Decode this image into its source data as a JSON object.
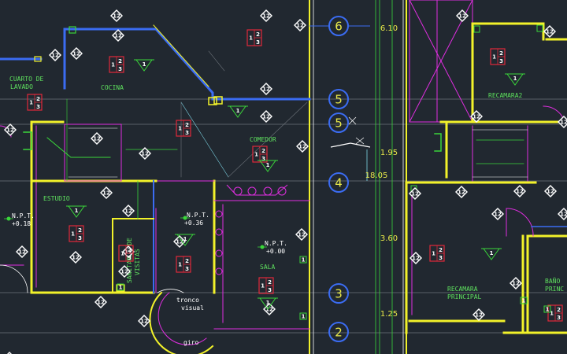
{
  "rooms": {
    "cuarto_lavado_1": "CUARTO DE",
    "cuarto_lavado_2": "LAVADO",
    "cocina": "COCINA",
    "comedor": "COMEDOR",
    "estudio": "ESTUDIO",
    "sala": "SALA",
    "sanitario_1": "SANITARIO DE",
    "sanitario_2": "VISITAS",
    "recamara2": "RECAMARA2",
    "recamara_principal_1": "RECAMARA",
    "recamara_principal_2": "PRINCIPAL",
    "bano_1": "BAÑO",
    "bano_2": "PRINC"
  },
  "levels": {
    "npt_label": "N.P.T.",
    "left_value": "+0.18",
    "center_value": "+0.36",
    "sala_value": "+0.00"
  },
  "notes": {
    "tronco_1": "tronco",
    "tronco_2": "visual",
    "giro": "giro"
  },
  "axes": [
    "6",
    "5",
    "5",
    "4",
    "3",
    "2"
  ],
  "dimensions": [
    "6.10",
    "1.95",
    "18.05",
    "3.60",
    "1.25"
  ],
  "symbols": {
    "diamond": "12",
    "box_a": "1",
    "box_b": "2",
    "box_c": "3",
    "tri": "1"
  },
  "colors": {
    "background": "#212830",
    "wall_yellow": "#f2f22a",
    "wall_blue": "#3b6cf2",
    "magenta": "#e02ee0",
    "green": "#3ad63a",
    "white": "#ffffff",
    "cyan": "#7fd8e8"
  }
}
